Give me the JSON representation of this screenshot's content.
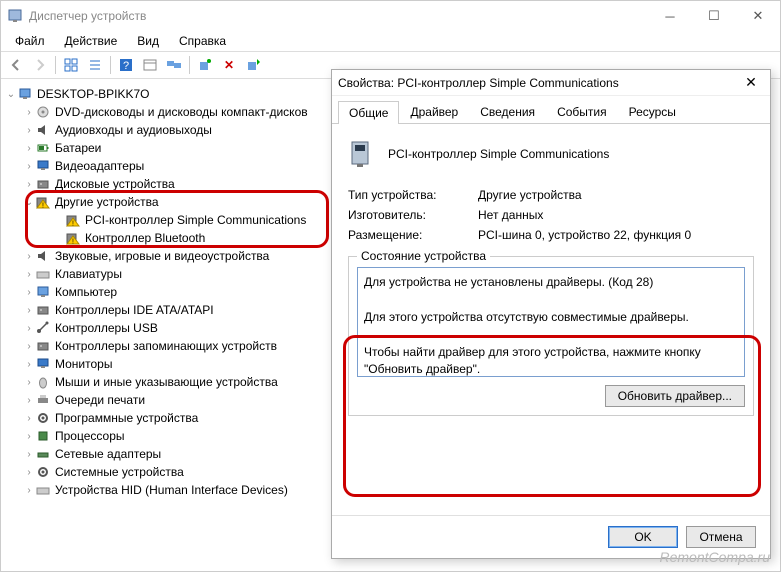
{
  "window": {
    "title": "Диспетчер устройств"
  },
  "menu": {
    "file": "Файл",
    "action": "Действие",
    "view": "Вид",
    "help": "Справка"
  },
  "tree": {
    "root": "DESKTOP-BPIKK7O",
    "items": [
      "DVD-дисководы и дисководы компакт-дисков",
      "Аудиовходы и аудиовыходы",
      "Батареи",
      "Видеоадаптеры",
      "Дисковые устройства"
    ],
    "other_devices": "Другие устройства",
    "other_children": [
      "PCI-контроллер Simple Communications",
      "Кoнтроллер Bluetooth"
    ],
    "items2": [
      "Звуковые, игровые и видеоустройства",
      "Клавиатуры",
      "Компьютер",
      "Контроллеры IDE ATA/ATAPI",
      "Контроллеры USB",
      "Контроллеры запоминающих устройств",
      "Мониторы",
      "Мыши и иные указывающие устройства",
      "Очереди печати",
      "Программные устройства",
      "Процессоры",
      "Сетевые адаптеры",
      "Системные устройства",
      "Устройства HID (Human Interface Devices)"
    ]
  },
  "dialog": {
    "title": "Свойства: PCI-контроллер Simple Communications",
    "tabs": {
      "general": "Общие",
      "driver": "Драйвер",
      "details": "Сведения",
      "events": "События",
      "resources": "Ресурсы"
    },
    "device_name": "PCI-контроллер Simple Communications",
    "type_label": "Тип устройства:",
    "type_value": "Другие устройства",
    "manufacturer_label": "Изготовитель:",
    "manufacturer_value": "Нет данных",
    "location_label": "Размещение:",
    "location_value": "PCI-шина 0, устройство 22, функция 0",
    "status_group": "Состояние устройства",
    "status_lines": {
      "l1": "Для устройства не установлены драйверы. (Код 28)",
      "l2": "Для этого устройства отсутствую совместимые драйверы.",
      "l3": "Чтобы найти драйвер для этого устройства, нажмите кнопку \"Обновить драйвер\"."
    },
    "update_driver": "Обновить драйвер...",
    "ok": "OK",
    "cancel": "Отмена"
  },
  "watermark": "RemontCompa.ru"
}
